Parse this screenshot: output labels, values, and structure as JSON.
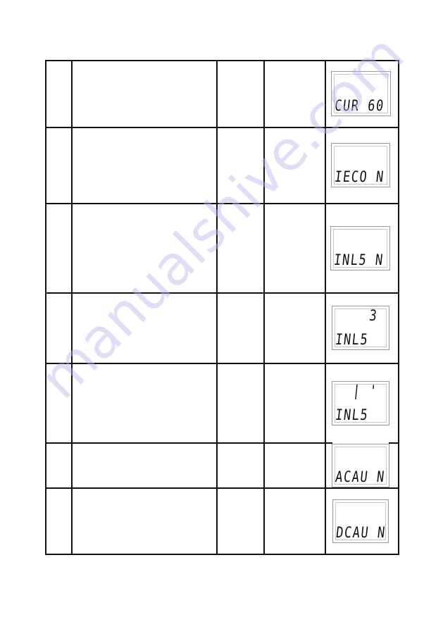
{
  "table": {
    "rows": [
      {
        "col1": "",
        "col2": "",
        "col3": "",
        "col4": "",
        "display": {
          "top": "",
          "bottom": "CUR 60"
        }
      },
      {
        "col1": "",
        "col2": "",
        "col3": "",
        "col4": "",
        "display": {
          "top": "",
          "bottom": "IECO N"
        }
      },
      {
        "col1": "",
        "col2": "",
        "col3": "",
        "col4": "",
        "display": {
          "top": "",
          "bottom": "INL5 N"
        }
      },
      {
        "col1": "",
        "col2": "",
        "col3": "",
        "col4": "",
        "display": {
          "top": "3",
          "bottom": "INL5"
        }
      },
      {
        "col1": "",
        "col2": "",
        "col3": "",
        "col4": "",
        "display": {
          "top": "| '",
          "bottom": "INL5"
        }
      },
      {
        "col1": "",
        "col2": "",
        "col3": "",
        "col4": "",
        "display": {
          "top": "",
          "bottom": "ACAU N"
        }
      },
      {
        "col1": "",
        "col2": "",
        "col3": "",
        "col4": "",
        "display": {
          "top": "",
          "bottom": "DCAU N"
        }
      }
    ]
  },
  "watermark": "manualshive.com"
}
